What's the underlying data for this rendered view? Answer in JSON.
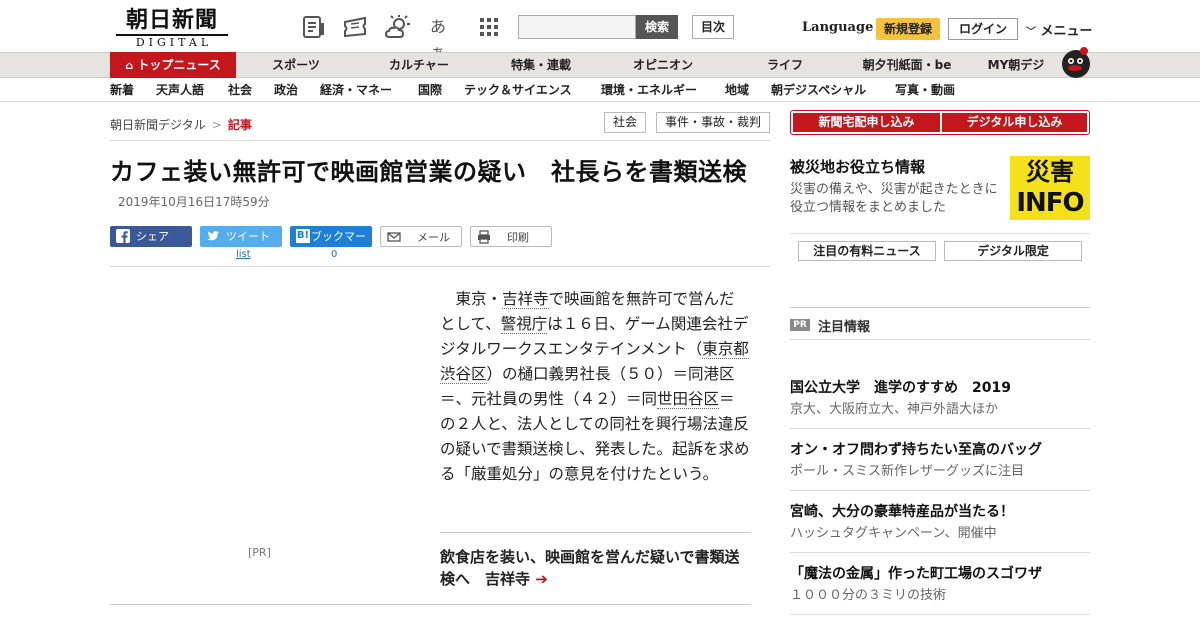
{
  "header": {
    "logo_top": "朝日新聞",
    "logo_bottom": "DIGITAL",
    "search_button": "検索",
    "toc_button": "目次",
    "language": "Language",
    "register": "新規登録",
    "login": "ログイン",
    "menu": "メニュー",
    "icons": [
      "newspaper-icon",
      "ticket-icon",
      "weather-icon",
      "font-size-icon",
      "grid-icon"
    ],
    "font_size_glyph": "あぁ"
  },
  "nav_primary": [
    "トップニュース",
    "スポーツ",
    "カルチャー",
    "特集・連載",
    "オピニオン",
    "ライフ",
    "朝夕刊紙面・be",
    "MY朝デジ"
  ],
  "nav_secondary": [
    "新着",
    "天声人語",
    "社会",
    "政治",
    "経済・マネー",
    "国際",
    "テック＆サイエンス",
    "環境・エネルギー",
    "地域",
    "朝デジスペシャル",
    "写真・動画"
  ],
  "breadcrumb": {
    "home": "朝日新聞デジタル",
    "separator": ">",
    "current": "記事"
  },
  "tags": [
    "社会",
    "事件・事故・裁判"
  ],
  "article": {
    "headline": "カフェ装い無許可で映画館営業の疑い　社長らを書類送検",
    "date": "2019年10月16日17時59分",
    "body_parts": [
      "　東京・",
      "吉祥寺",
      "で映画館を無許可で営んだとして、",
      "警視庁",
      "は１６日、ゲーム関連会社デジタルワークスエンタテインメント（",
      "東京都",
      "渋谷区",
      "）の樋口義男社長（５０）＝同港区＝、元社員の男性（４２）＝同",
      "世田谷区",
      "＝の２人と、法人としての同社を興行場法違反の疑いで書類送検し、発表した。起訴を求める「厳重処分」の意見を付けたという。"
    ],
    "ad_label": "[PR]",
    "related": "飲食店を装い、映画館を営んだ疑いで書類送検へ　吉祥寺",
    "related_arrow": "➔"
  },
  "share": {
    "facebook": "シェア",
    "twitter": "ツイート",
    "hatena": "ブックマーク",
    "mail": "メール",
    "print": "印刷",
    "twitter_count": "list",
    "hatena_count": "0"
  },
  "sidebar": {
    "subscribe_paper": "新聞宅配申し込み",
    "subscribe_digital": "デジタル申し込み",
    "disaster_title": "被災地お役立ち情報",
    "disaster_desc": "災害の備えや、災害が起きたときに役立つ情報をまとめました",
    "disaster_badge_1": "災害",
    "disaster_badge_2": "INFO",
    "tab_paid": "注目の有料ニュース",
    "tab_digital": "デジタル限定",
    "pr_badge": "PR",
    "pr_title": "注目情報",
    "pr_items": [
      {
        "title": "国公立大学　進学のすすめ　2019",
        "sub": "京大、大阪府立大、神戸外語大ほか"
      },
      {
        "title": "オン・オフ問わず持ちたい至高のバッグ",
        "sub": "ポール・スミス新作レザーグッズに注目"
      },
      {
        "title": "宮崎、大分の豪華特産品が当たる！",
        "sub": "ハッシュタグキャンペーン、開催中"
      },
      {
        "title": "「魔法の金属」作った町工場のスゴワザ",
        "sub": "１０００分の３ミリの技術"
      }
    ]
  },
  "colors": {
    "accent": "#c4161c",
    "register": "#f5c33b",
    "facebook": "#3b5998",
    "twitter": "#55acee",
    "hatena": "#1d7fd6",
    "disaster": "#f5e11a"
  }
}
